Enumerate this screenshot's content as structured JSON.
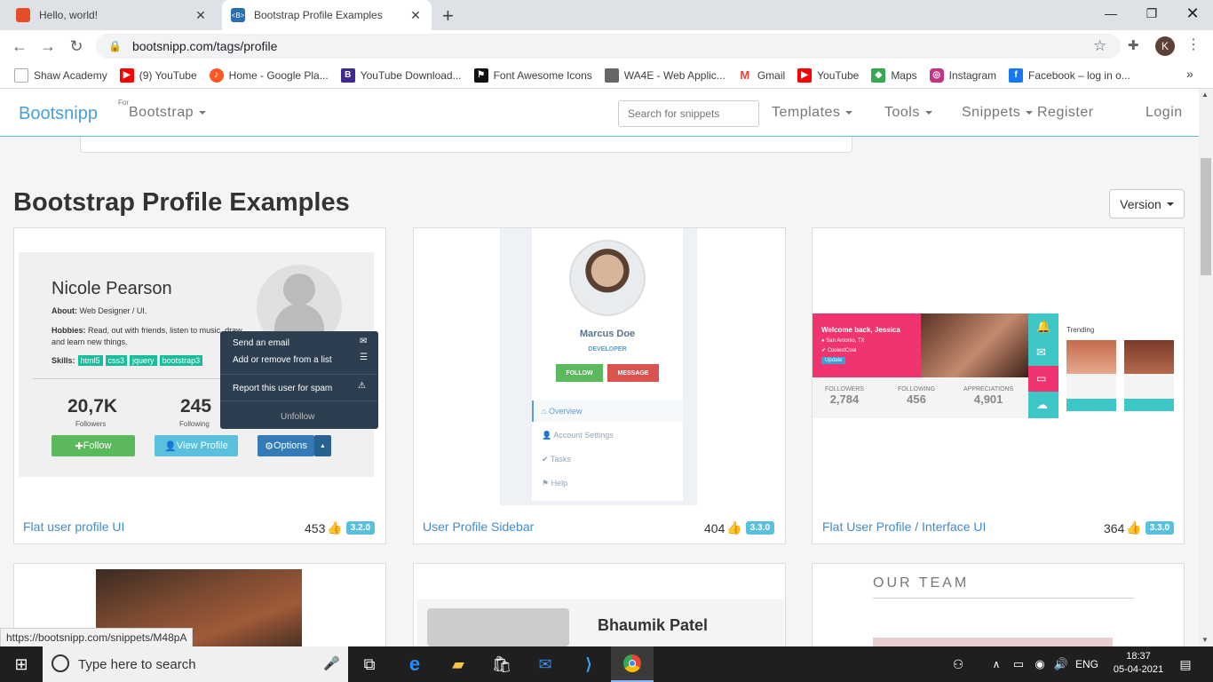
{
  "browser": {
    "tabs": [
      {
        "title": "Hello, world!",
        "favicon_color": "#e44d26"
      },
      {
        "title": "Bootstrap Profile Examples",
        "favicon_color": "#563d7c"
      }
    ],
    "new_tab_label": "+",
    "url": "bootsnipp.com/tags/profile",
    "profile_initial": "K",
    "bookmarks": [
      {
        "label": "Shaw Academy",
        "icon": "shaw-academy-icon",
        "color": "#ffffff"
      },
      {
        "label": "(9) YouTube",
        "icon": "youtube-icon",
        "color": "#ff0000"
      },
      {
        "label": "Home - Google Pla...",
        "icon": "google-play-icon",
        "color": "#ff5722"
      },
      {
        "label": "YouTube Download...",
        "icon": "b-icon",
        "color": "#3f2a8f"
      },
      {
        "label": "Font Awesome Icons",
        "icon": "flag-icon",
        "color": "#111111"
      },
      {
        "label": "WA4E - Web Applic...",
        "icon": "wa4e-icon",
        "color": "#666666"
      },
      {
        "label": "Gmail",
        "icon": "gmail-icon",
        "color": "#ea4335"
      },
      {
        "label": "YouTube",
        "icon": "youtube-icon",
        "color": "#ff0000"
      },
      {
        "label": "Maps",
        "icon": "maps-icon",
        "color": "#34a853"
      },
      {
        "label": "Instagram",
        "icon": "instagram-icon",
        "color": "#c13584"
      },
      {
        "label": "Facebook – log in o...",
        "icon": "facebook-icon",
        "color": "#1877f2"
      }
    ],
    "bookmarks_more": "»",
    "status_url": "https://bootsnipp.com/snippets/M48pA"
  },
  "site": {
    "brand": "Bootsnipp",
    "for_label": "For",
    "bootstrap_menu": "Bootstrap",
    "search_placeholder": "Search for snippets",
    "nav": {
      "templates": "Templates",
      "tools": "Tools",
      "snippets": "Snippets",
      "register": "Register",
      "login": "Login"
    },
    "page_title": "Bootstrap Profile Examples",
    "version_button": "Version",
    "cards": [
      {
        "title": "Flat user profile UI",
        "likes": "453",
        "version": "3.2.0",
        "preview": {
          "name": "Nicole Pearson",
          "about_label": "About:",
          "about": "Web Designer / UI.",
          "hobbies_label": "Hobbies:",
          "hobbies": "Read, out with friends, listen to music, draw and learn new things.",
          "skills_label": "Skills:",
          "skills": [
            "html5",
            "css3",
            "jquery",
            "bootstrap3"
          ],
          "followers_value": "20,7K",
          "followers_label": "Followers",
          "following_value": "245",
          "following_label": "Following",
          "follow_btn": "Follow",
          "view_btn": "View Profile",
          "options_btn": "Options",
          "menu": [
            "Send an email",
            "Add or remove from a list",
            "Report this user for spam",
            "Unfollow"
          ]
        }
      },
      {
        "title": "User Profile Sidebar",
        "likes": "404",
        "version": "3.3.0",
        "preview": {
          "name": "Marcus Doe",
          "role": "DEVELOPER",
          "follow_btn": "FOLLOW",
          "message_btn": "MESSAGE",
          "menu": [
            "Overview",
            "Account Settings",
            "Tasks",
            "Help"
          ]
        }
      },
      {
        "title": "Flat User Profile / Interface UI",
        "likes": "364",
        "version": "3.3.0",
        "preview": {
          "welcome": "Welcome back, Jessica",
          "location": "San Antonio, TX",
          "handle": "CoolestCool",
          "update_btn": "Update",
          "trending": "Trending",
          "stats": [
            {
              "label": "FOLLOWERS",
              "value": "2,784"
            },
            {
              "label": "FOLLOWING",
              "value": "456"
            },
            {
              "label": "APPRECIATIONS",
              "value": "4,901"
            }
          ]
        }
      }
    ],
    "row2": {
      "card2_name": "Bhaumik Patel",
      "card3_heading": "OUR TEAM"
    }
  },
  "taskbar": {
    "search_placeholder": "Type here to search",
    "language": "ENG",
    "time": "18:37",
    "date": "05-04-2021"
  }
}
